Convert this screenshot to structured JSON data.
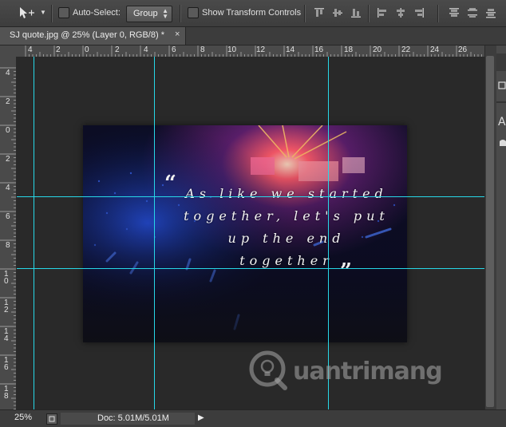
{
  "options_bar": {
    "auto_select_label": "Auto-Select:",
    "auto_select_checked": false,
    "group_value": "Group",
    "show_transform_label": "Show Transform Controls",
    "show_transform_checked": false
  },
  "document_tab": {
    "title": "SJ quote.jpg @ 25% (Layer 0, RGB/8) *",
    "close_glyph": "×"
  },
  "ruler_top": [
    "4",
    "2",
    "0",
    "2",
    "4",
    "6",
    "8",
    "10",
    "12",
    "14",
    "16",
    "18",
    "20",
    "22",
    "24",
    "26"
  ],
  "ruler_left": [
    "4",
    "2",
    "0",
    "2",
    "4",
    "6",
    "8",
    "10",
    "12",
    "14",
    "16",
    "18"
  ],
  "quote": {
    "open_mark": "“",
    "close_mark": "”",
    "lines": [
      "As like we started",
      "together, let's put",
      "up the end",
      "together"
    ]
  },
  "watermark": {
    "text": "uantrimang"
  },
  "status_bar": {
    "zoom": "25%",
    "doc_size": "Doc: 5.01M/5.01M"
  },
  "colors": {
    "guide": "#27d8e8",
    "canvas_bg": "#292929",
    "ui_bg": "#535353"
  },
  "icons": [
    "move-tool-icon",
    "dropdown-arrow-icon",
    "align-icons",
    "status-menu-arrow-icon",
    "stage-crowd-photo",
    "watermark-bulb-logo"
  ]
}
